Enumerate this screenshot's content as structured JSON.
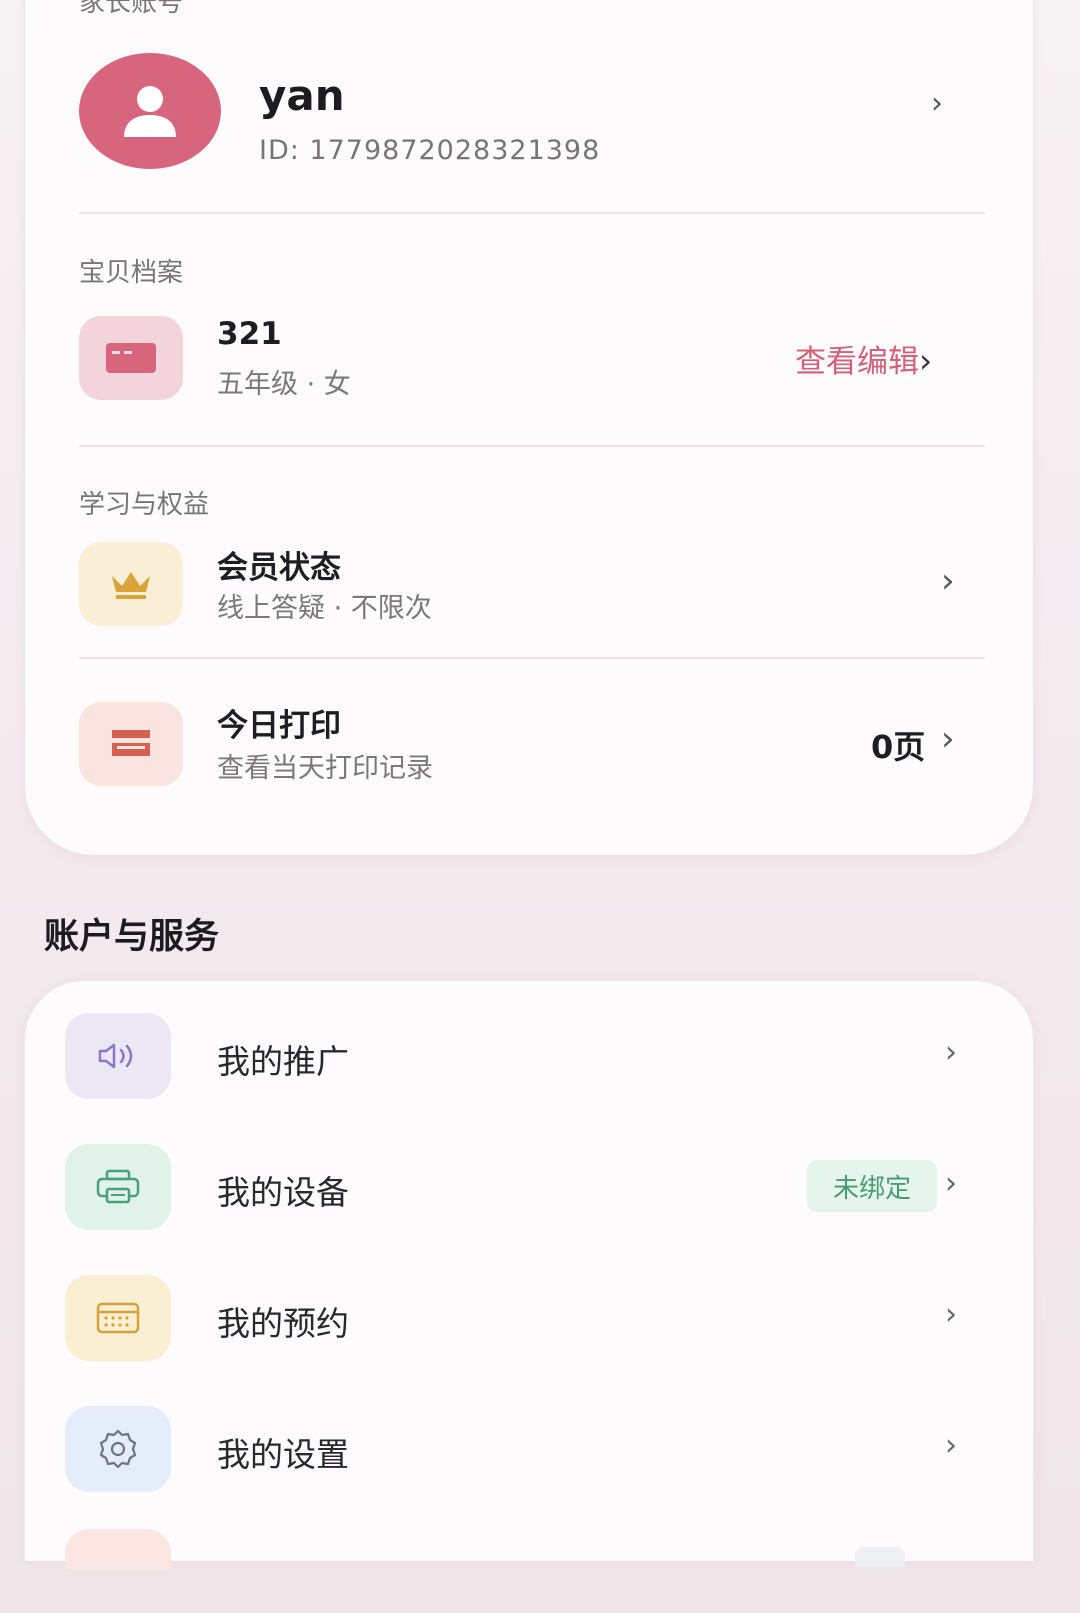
{
  "parent": {
    "section_label": "家长账号",
    "name": "yan",
    "id_text": "ID: 1779872028321398"
  },
  "child": {
    "section_label": "宝贝档案",
    "name": "321",
    "info": "五年级 · 女",
    "edit_label": "查看编辑"
  },
  "study": {
    "section_label": "学习与权益",
    "member_title": "会员状态",
    "member_sub": "线上答疑 · 不限次",
    "print_title": "今日打印",
    "print_sub": "查看当天打印记录",
    "print_value": "0页"
  },
  "services": {
    "title": "账户与服务",
    "items": [
      {
        "label": "我的推广",
        "icon": "megaphone-icon"
      },
      {
        "label": "我的设备",
        "icon": "printer-icon",
        "badge": "未绑定"
      },
      {
        "label": "我的预约",
        "icon": "calendar-icon"
      },
      {
        "label": "我的设置",
        "icon": "gear-icon"
      }
    ]
  },
  "colors": {
    "accent": "#d4607a",
    "avatar": "#d8657e",
    "badge_bg": "#e6f4ee",
    "badge_text": "#4a9a73"
  }
}
